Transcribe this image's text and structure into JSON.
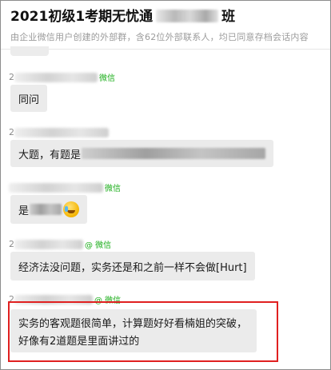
{
  "header": {
    "title_prefix": "2021初级1考期无忧通",
    "title_suffix": "班",
    "subtitle": "由企业微信用户创建的外部群，含62位外部联系人，均已同意存档会话内容"
  },
  "messages": [
    {
      "sender_prefix": "2",
      "source": "微信",
      "text": "同问"
    },
    {
      "sender_prefix": "2",
      "source": "",
      "text": "大题，有题是"
    },
    {
      "sender_prefix": "",
      "source": "微信",
      "text": "是"
    },
    {
      "sender_prefix": "2",
      "source": "@ 微信",
      "text": "经济法没问题，实务还是和之前一样不会做[Hurt]"
    },
    {
      "sender_prefix": "2",
      "source": "@ 微信",
      "text": "实务的客观题很简单，计算题好好看楠姐的突破，好像有2道题是里面讲过的"
    }
  ],
  "colors": {
    "wechat_tag": "#1aad19",
    "bubble": "#ebebeb",
    "highlight": "#e02020"
  }
}
